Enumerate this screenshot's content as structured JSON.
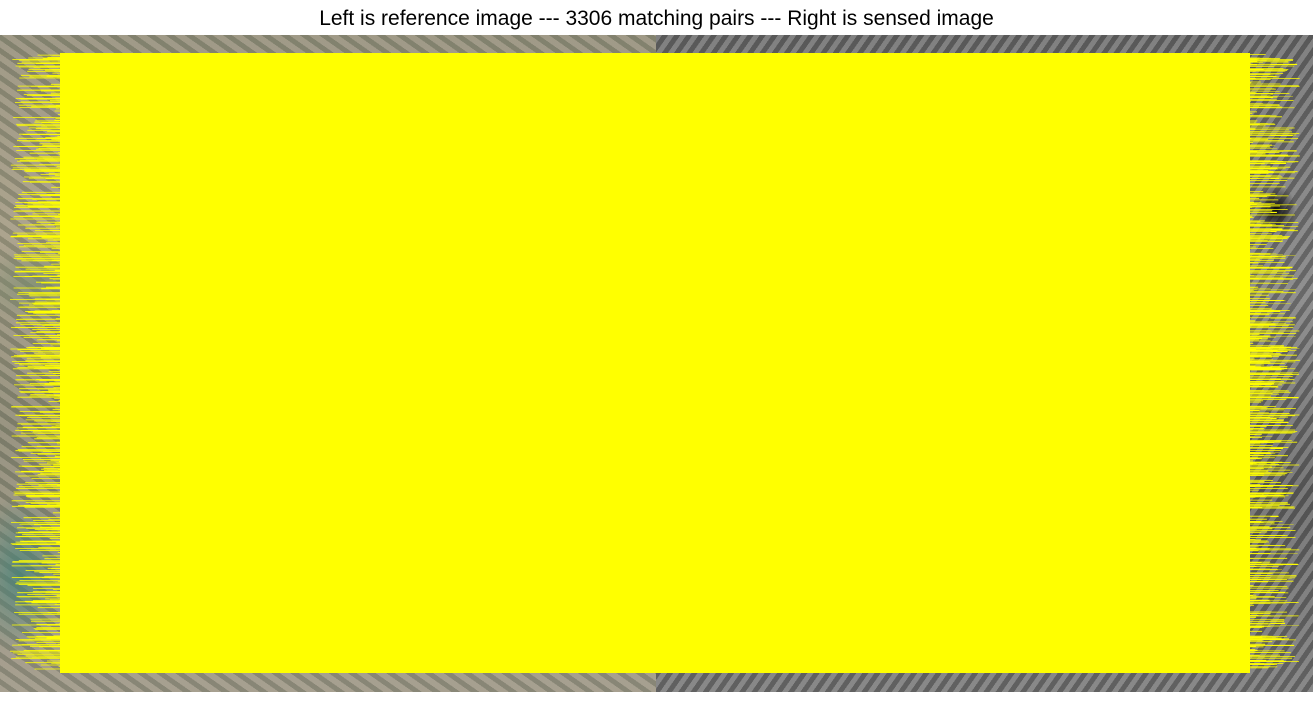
{
  "figure": {
    "title": "Left is reference image --- 3306 matching pairs --- Right is sensed image",
    "matching_pairs": 3306,
    "line_color": "#ffff00"
  },
  "panels": {
    "left": "reference image",
    "right": "sensed image"
  }
}
